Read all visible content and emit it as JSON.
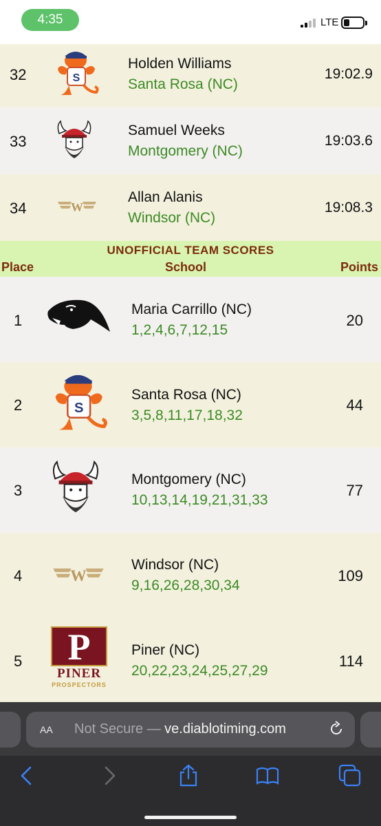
{
  "status_bar": {
    "time": "4:35",
    "network": "LTE"
  },
  "individual_results": [
    {
      "place": "32",
      "name": "Holden Williams",
      "school": "Santa Rosa (NC)",
      "time": "19:02.9",
      "logo": "santa-rosa-logo"
    },
    {
      "place": "33",
      "name": "Samuel Weeks",
      "school": "Montgomery (NC)",
      "time": "19:03.6",
      "logo": "montgomery-logo"
    },
    {
      "place": "34",
      "name": "Allan Alanis",
      "school": "Windsor (NC)",
      "time": "19:08.3",
      "logo": "windsor-logo"
    }
  ],
  "team_scores": {
    "title": "UNOFFICIAL TEAM SCORES",
    "columns": {
      "place": "Place",
      "school": "School",
      "points": "Points"
    },
    "rows": [
      {
        "place": "1",
        "school": "Maria Carrillo (NC)",
        "finishers": "1,2,4,6,7,12,15",
        "points": "20",
        "logo": "maria-carrillo-logo"
      },
      {
        "place": "2",
        "school": "Santa Rosa (NC)",
        "finishers": "3,5,8,11,17,18,32",
        "points": "44",
        "logo": "santa-rosa-logo"
      },
      {
        "place": "3",
        "school": "Montgomery (NC)",
        "finishers": "10,13,14,19,21,31,33",
        "points": "77",
        "logo": "montgomery-logo"
      },
      {
        "place": "4",
        "school": "Windsor (NC)",
        "finishers": "9,16,26,28,30,34",
        "points": "109",
        "logo": "windsor-logo"
      },
      {
        "place": "5",
        "school": "Piner (NC)",
        "finishers": "20,22,23,24,25,27,29",
        "points": "114",
        "logo": "piner-logo",
        "logo_text": {
          "letter": "P",
          "word": "PINER",
          "sub": "PROSPECTORS"
        }
      }
    ]
  },
  "browser": {
    "text_size_label": "AA",
    "security_label": "Not Secure —",
    "url": "ve.diablotiming.com"
  },
  "colors": {
    "row_alt_a": "#f3f1de",
    "row_alt_b": "#f3f1f0",
    "school_green": "#3c8a24",
    "header_bg": "#d9f4b0",
    "header_text": "#7b2b0a",
    "status_pill": "#5ec26a",
    "toolbar_blue": "#3b82f6"
  }
}
